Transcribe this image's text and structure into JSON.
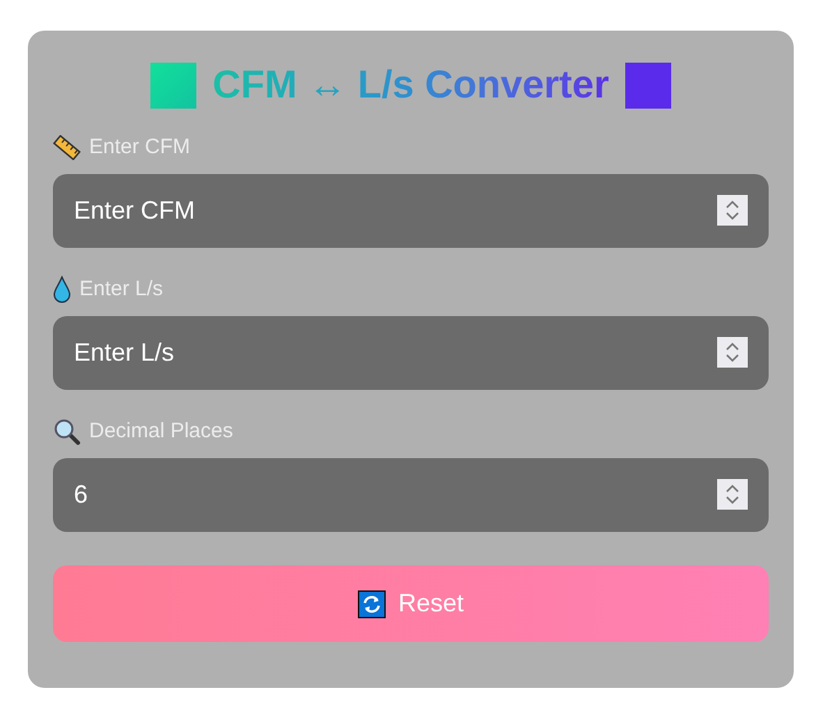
{
  "title": "CFM ↔ L/s Converter",
  "fields": [
    {
      "kind": "ruler",
      "label": "Enter CFM",
      "placeholder": "Enter CFM"
    },
    {
      "kind": "drop",
      "label": "Enter L/s",
      "placeholder": "Enter L/s"
    },
    {
      "kind": "magnifier",
      "label": "Decimal Places",
      "value": "6"
    }
  ],
  "reset_button": "Reset"
}
